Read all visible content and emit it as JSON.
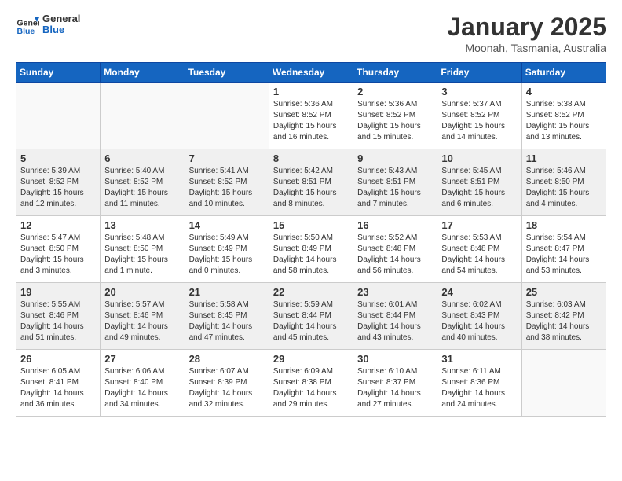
{
  "header": {
    "logo_line1": "General",
    "logo_line2": "Blue",
    "month": "January 2025",
    "location": "Moonah, Tasmania, Australia"
  },
  "days_of_week": [
    "Sunday",
    "Monday",
    "Tuesday",
    "Wednesday",
    "Thursday",
    "Friday",
    "Saturday"
  ],
  "weeks": [
    [
      {
        "day": "",
        "info": ""
      },
      {
        "day": "",
        "info": ""
      },
      {
        "day": "",
        "info": ""
      },
      {
        "day": "1",
        "info": "Sunrise: 5:36 AM\nSunset: 8:52 PM\nDaylight: 15 hours\nand 16 minutes."
      },
      {
        "day": "2",
        "info": "Sunrise: 5:36 AM\nSunset: 8:52 PM\nDaylight: 15 hours\nand 15 minutes."
      },
      {
        "day": "3",
        "info": "Sunrise: 5:37 AM\nSunset: 8:52 PM\nDaylight: 15 hours\nand 14 minutes."
      },
      {
        "day": "4",
        "info": "Sunrise: 5:38 AM\nSunset: 8:52 PM\nDaylight: 15 hours\nand 13 minutes."
      }
    ],
    [
      {
        "day": "5",
        "info": "Sunrise: 5:39 AM\nSunset: 8:52 PM\nDaylight: 15 hours\nand 12 minutes."
      },
      {
        "day": "6",
        "info": "Sunrise: 5:40 AM\nSunset: 8:52 PM\nDaylight: 15 hours\nand 11 minutes."
      },
      {
        "day": "7",
        "info": "Sunrise: 5:41 AM\nSunset: 8:52 PM\nDaylight: 15 hours\nand 10 minutes."
      },
      {
        "day": "8",
        "info": "Sunrise: 5:42 AM\nSunset: 8:51 PM\nDaylight: 15 hours\nand 8 minutes."
      },
      {
        "day": "9",
        "info": "Sunrise: 5:43 AM\nSunset: 8:51 PM\nDaylight: 15 hours\nand 7 minutes."
      },
      {
        "day": "10",
        "info": "Sunrise: 5:45 AM\nSunset: 8:51 PM\nDaylight: 15 hours\nand 6 minutes."
      },
      {
        "day": "11",
        "info": "Sunrise: 5:46 AM\nSunset: 8:50 PM\nDaylight: 15 hours\nand 4 minutes."
      }
    ],
    [
      {
        "day": "12",
        "info": "Sunrise: 5:47 AM\nSunset: 8:50 PM\nDaylight: 15 hours\nand 3 minutes."
      },
      {
        "day": "13",
        "info": "Sunrise: 5:48 AM\nSunset: 8:50 PM\nDaylight: 15 hours\nand 1 minute."
      },
      {
        "day": "14",
        "info": "Sunrise: 5:49 AM\nSunset: 8:49 PM\nDaylight: 15 hours\nand 0 minutes."
      },
      {
        "day": "15",
        "info": "Sunrise: 5:50 AM\nSunset: 8:49 PM\nDaylight: 14 hours\nand 58 minutes."
      },
      {
        "day": "16",
        "info": "Sunrise: 5:52 AM\nSunset: 8:48 PM\nDaylight: 14 hours\nand 56 minutes."
      },
      {
        "day": "17",
        "info": "Sunrise: 5:53 AM\nSunset: 8:48 PM\nDaylight: 14 hours\nand 54 minutes."
      },
      {
        "day": "18",
        "info": "Sunrise: 5:54 AM\nSunset: 8:47 PM\nDaylight: 14 hours\nand 53 minutes."
      }
    ],
    [
      {
        "day": "19",
        "info": "Sunrise: 5:55 AM\nSunset: 8:46 PM\nDaylight: 14 hours\nand 51 minutes."
      },
      {
        "day": "20",
        "info": "Sunrise: 5:57 AM\nSunset: 8:46 PM\nDaylight: 14 hours\nand 49 minutes."
      },
      {
        "day": "21",
        "info": "Sunrise: 5:58 AM\nSunset: 8:45 PM\nDaylight: 14 hours\nand 47 minutes."
      },
      {
        "day": "22",
        "info": "Sunrise: 5:59 AM\nSunset: 8:44 PM\nDaylight: 14 hours\nand 45 minutes."
      },
      {
        "day": "23",
        "info": "Sunrise: 6:01 AM\nSunset: 8:44 PM\nDaylight: 14 hours\nand 43 minutes."
      },
      {
        "day": "24",
        "info": "Sunrise: 6:02 AM\nSunset: 8:43 PM\nDaylight: 14 hours\nand 40 minutes."
      },
      {
        "day": "25",
        "info": "Sunrise: 6:03 AM\nSunset: 8:42 PM\nDaylight: 14 hours\nand 38 minutes."
      }
    ],
    [
      {
        "day": "26",
        "info": "Sunrise: 6:05 AM\nSunset: 8:41 PM\nDaylight: 14 hours\nand 36 minutes."
      },
      {
        "day": "27",
        "info": "Sunrise: 6:06 AM\nSunset: 8:40 PM\nDaylight: 14 hours\nand 34 minutes."
      },
      {
        "day": "28",
        "info": "Sunrise: 6:07 AM\nSunset: 8:39 PM\nDaylight: 14 hours\nand 32 minutes."
      },
      {
        "day": "29",
        "info": "Sunrise: 6:09 AM\nSunset: 8:38 PM\nDaylight: 14 hours\nand 29 minutes."
      },
      {
        "day": "30",
        "info": "Sunrise: 6:10 AM\nSunset: 8:37 PM\nDaylight: 14 hours\nand 27 minutes."
      },
      {
        "day": "31",
        "info": "Sunrise: 6:11 AM\nSunset: 8:36 PM\nDaylight: 14 hours\nand 24 minutes."
      },
      {
        "day": "",
        "info": ""
      }
    ]
  ]
}
